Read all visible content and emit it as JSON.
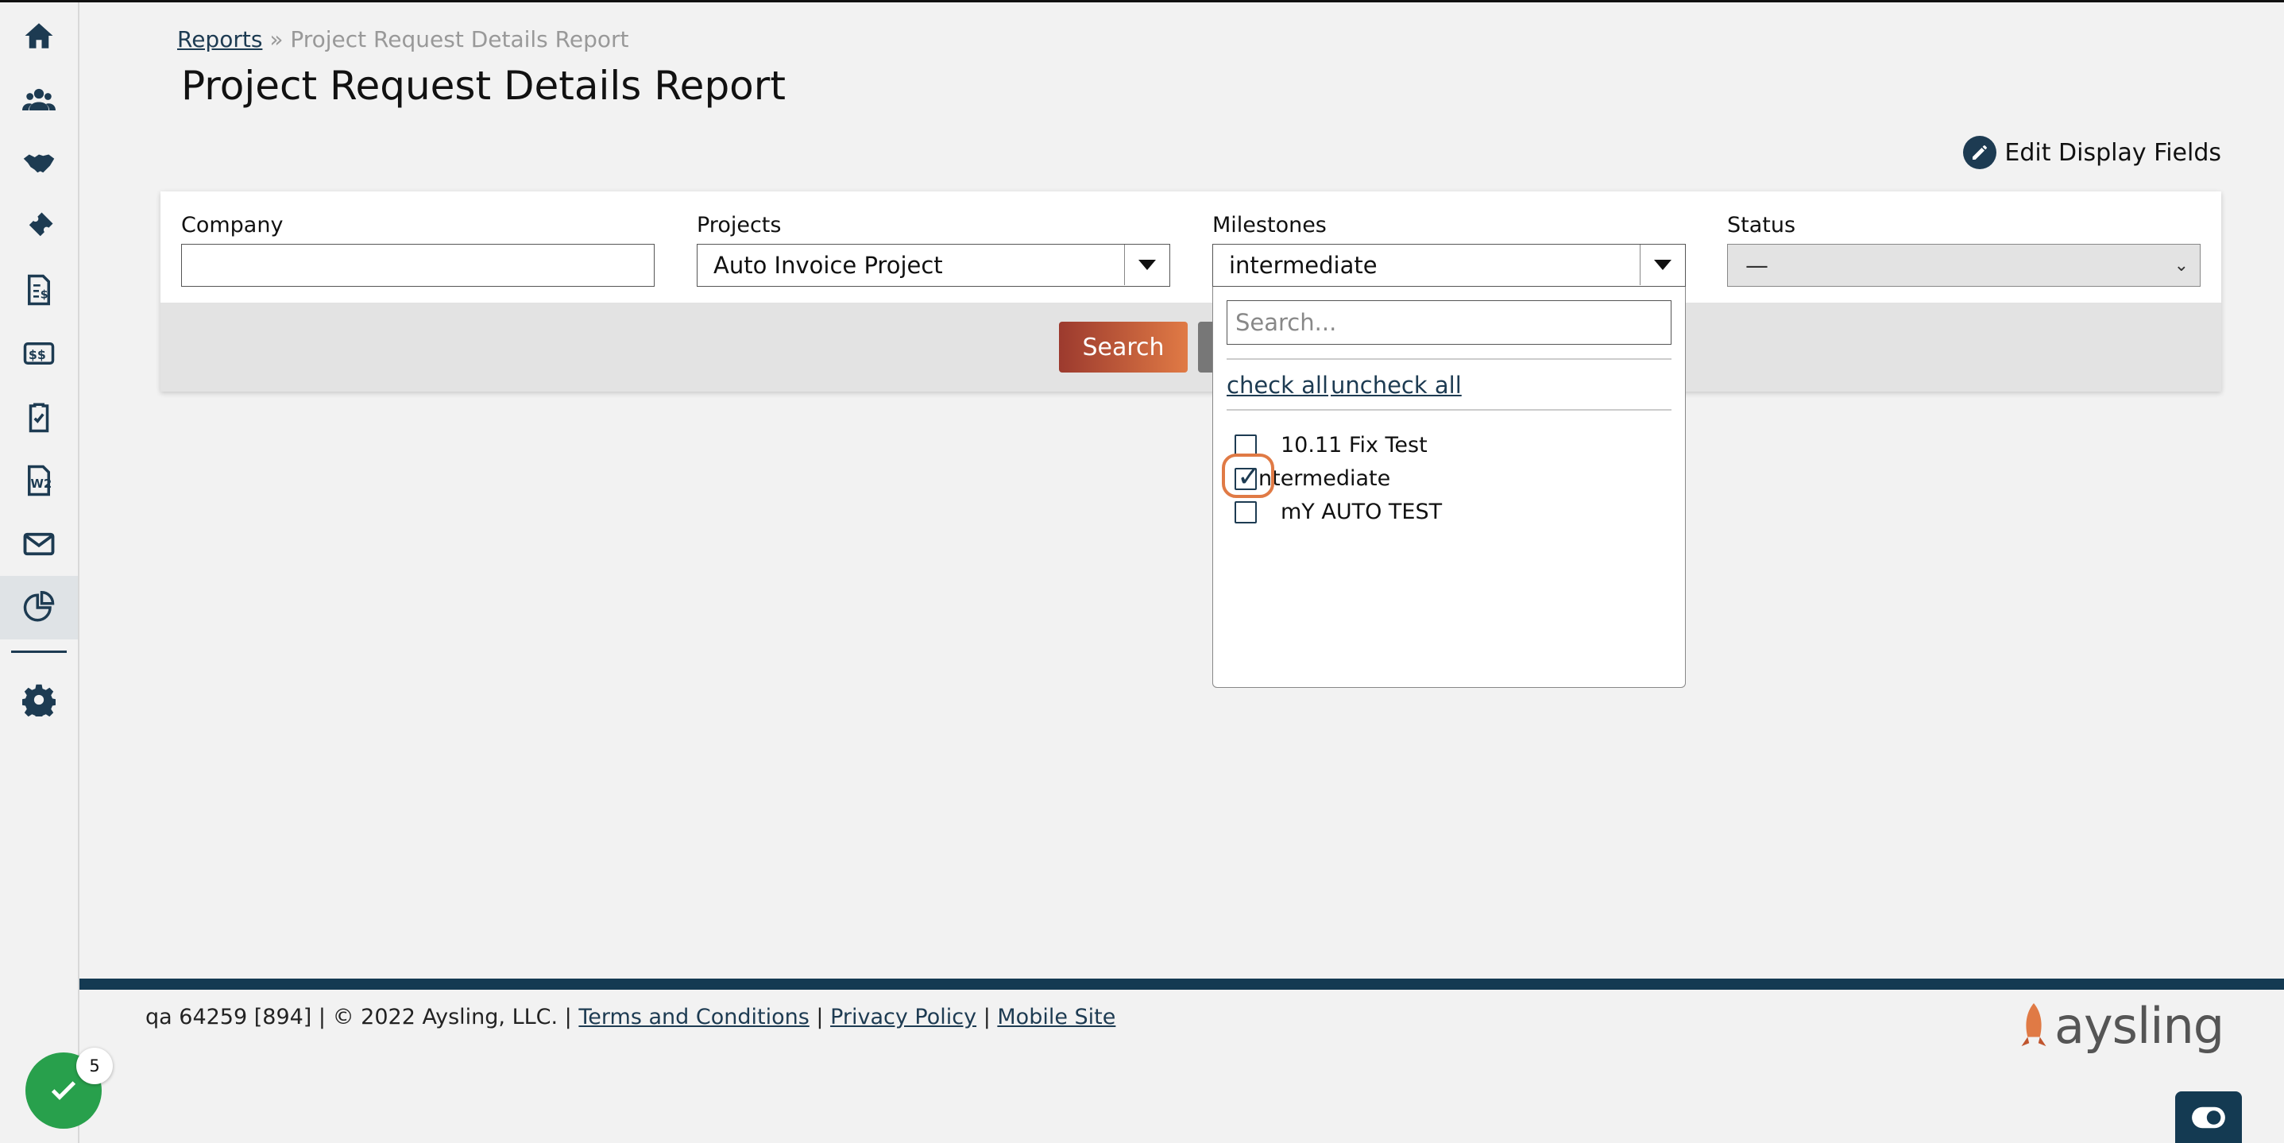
{
  "sidebar": {
    "items": [
      {
        "icon": "home-icon"
      },
      {
        "icon": "users-icon"
      },
      {
        "icon": "handshake-icon"
      },
      {
        "icon": "ticket-icon"
      },
      {
        "icon": "invoice-icon"
      },
      {
        "icon": "exchange-icon"
      },
      {
        "icon": "clipboard-check-icon"
      },
      {
        "icon": "w2-form-icon"
      },
      {
        "icon": "mail-icon"
      },
      {
        "icon": "reports-chart-icon",
        "active": true
      },
      {
        "icon": "gear-icon"
      }
    ]
  },
  "breadcrumb": {
    "root": "Reports",
    "separator": "»",
    "current": "Project Request Details Report"
  },
  "page": {
    "title": "Project Request Details Report"
  },
  "toolbar": {
    "edit_fields_label": "Edit Display Fields"
  },
  "filters": {
    "company": {
      "label": "Company",
      "value": ""
    },
    "projects": {
      "label": "Projects",
      "value": "Auto Invoice Project"
    },
    "milestones": {
      "label": "Milestones",
      "value": "intermediate"
    },
    "status": {
      "label": "Status",
      "value": "—"
    }
  },
  "actions": {
    "search_label": "Search"
  },
  "milestone_dropdown": {
    "search_placeholder": "Search...",
    "check_all": "check all",
    "uncheck_all": "uncheck all",
    "options": [
      {
        "label": "10.11 Fix Test",
        "checked": false
      },
      {
        "label": "ntermediate",
        "checked": true
      },
      {
        "label": "mY AUTO TEST",
        "checked": false
      }
    ]
  },
  "footer": {
    "info": "qa 64259 [894] | © 2022 Aysling, LLC. |",
    "terms": "Terms and Conditions",
    "sep": "|",
    "privacy": "Privacy Policy",
    "mobile": "Mobile Site"
  },
  "brand": {
    "name": "aysling",
    "accent": "#e07a45"
  },
  "tasks": {
    "count": "5"
  },
  "colors": {
    "primary": "#1d3b52",
    "footer_bar": "#143a52",
    "success": "#28a04c"
  }
}
